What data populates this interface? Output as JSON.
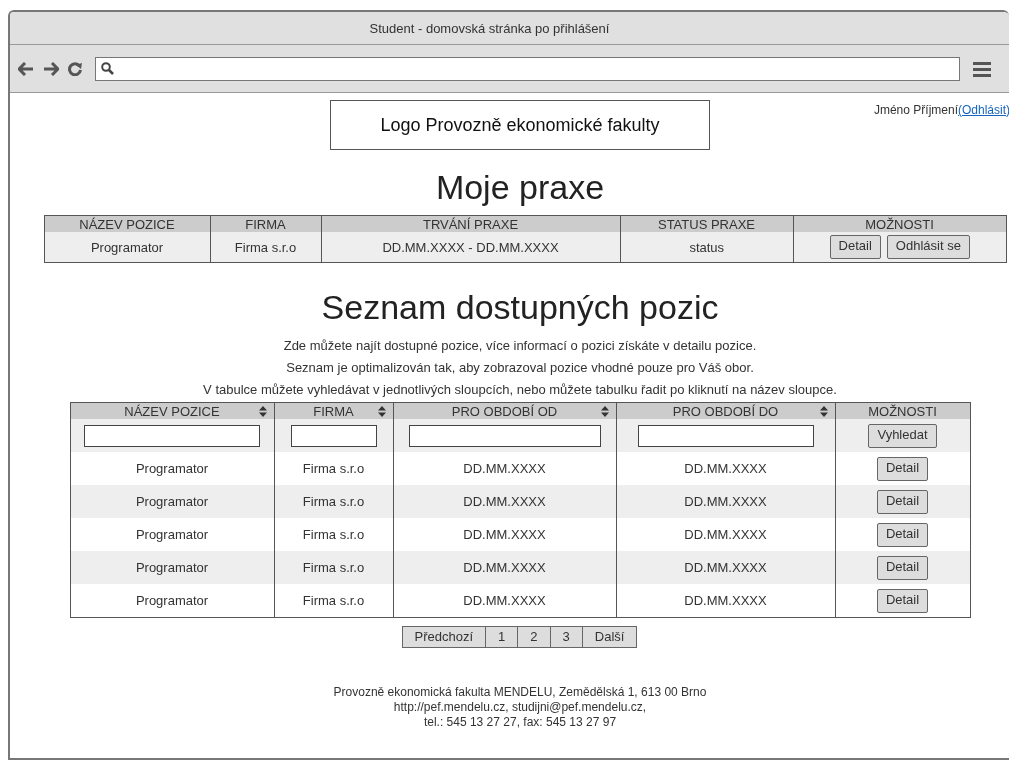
{
  "window": {
    "title": "Student - domovská stránka po přihlášení"
  },
  "user": {
    "name": "Jméno Příjmení",
    "logout_link": "(Odhlásit)"
  },
  "logo": "Logo Provozně ekonomické fakulty",
  "my_internships": {
    "heading": "Moje praxe",
    "columns": [
      "NÁZEV POZICE",
      "FIRMA",
      "TRVÁNÍ PRAXE",
      "STATUS PRAXE",
      "MOŽNOSTI"
    ],
    "rows": [
      {
        "cells": [
          "Programator",
          "Firma s.r.o",
          "DD.MM.XXXX - DD.MM.XXXX",
          "status"
        ],
        "buttons": [
          "Detail",
          "Odhlásit se"
        ]
      }
    ]
  },
  "positions": {
    "heading": "Seznam dostupných pozic",
    "intro": [
      "Zde můžete najít dostupné pozice, více informací o pozici získáte v detailu pozice.",
      "Seznam je optimalizován tak, aby zobrazoval pozice vhodné pouze pro Váš obor.",
      "V tabulce můžete vyhledávat v jednotlivých sloupcích, nebo můžete tabulku řadit po kliknutí na název sloupce."
    ],
    "columns": [
      {
        "label": "NÁZEV POZICE",
        "sortable": true
      },
      {
        "label": "FIRMA",
        "sortable": true
      },
      {
        "label": "PRO OBDOBÍ OD",
        "sortable": true
      },
      {
        "label": "PRO OBDOBÍ DO",
        "sortable": true
      },
      {
        "label": "MOŽNOSTI",
        "sortable": false
      }
    ],
    "search_button": "Vyhledat",
    "rows": [
      {
        "cells": [
          "Programator",
          "Firma s.r.o",
          "DD.MM.XXXX",
          "DD.MM.XXXX"
        ],
        "button": "Detail"
      },
      {
        "cells": [
          "Programator",
          "Firma s.r.o",
          "DD.MM.XXXX",
          "DD.MM.XXXX"
        ],
        "button": "Detail"
      },
      {
        "cells": [
          "Programator",
          "Firma s.r.o",
          "DD.MM.XXXX",
          "DD.MM.XXXX"
        ],
        "button": "Detail"
      },
      {
        "cells": [
          "Programator",
          "Firma s.r.o",
          "DD.MM.XXXX",
          "DD.MM.XXXX"
        ],
        "button": "Detail"
      },
      {
        "cells": [
          "Programator",
          "Firma s.r.o",
          "DD.MM.XXXX",
          "DD.MM.XXXX"
        ],
        "button": "Detail"
      }
    ],
    "pagination": [
      "Předchozí",
      "1",
      "2",
      "3",
      "Další"
    ]
  },
  "footer": [
    "Provozně ekonomická fakulta MENDELU, Zemědělská 1, 613 00 Brno",
    "http://pef.mendelu.cz, studijni@pef.mendelu.cz,",
    "tel.: 545 13 27 27, fax: 545 13 27 97"
  ]
}
